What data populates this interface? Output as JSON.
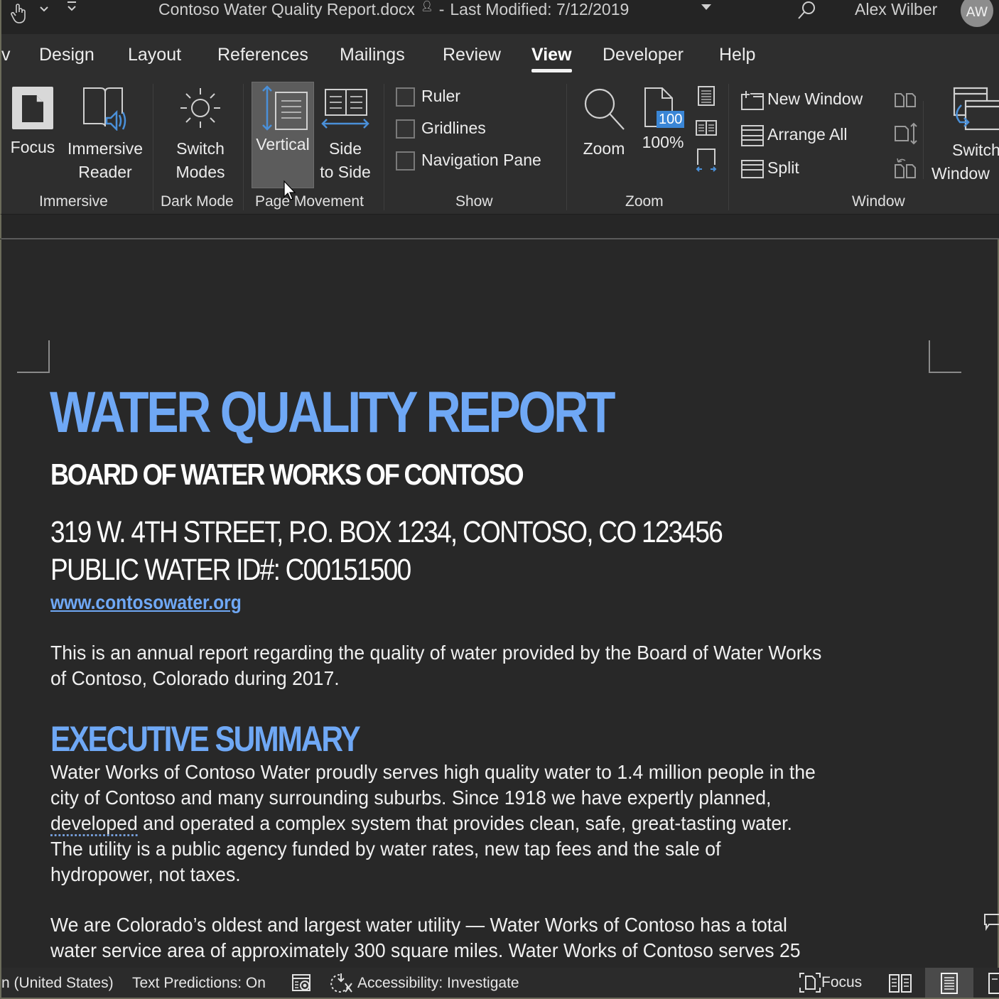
{
  "titlebar": {
    "doc_name": "Contoso Water Quality Report.docx",
    "separator": "-",
    "last_modified": "Last Modified: 7/12/2019",
    "user_name": "Alex Wilber",
    "avatar_initials": "AW"
  },
  "tabs": [
    {
      "label": "v"
    },
    {
      "label": "Design"
    },
    {
      "label": "Layout"
    },
    {
      "label": "References"
    },
    {
      "label": "Mailings"
    },
    {
      "label": "Review"
    },
    {
      "label": "View",
      "active": true
    },
    {
      "label": "Developer"
    },
    {
      "label": "Help"
    }
  ],
  "ribbon": {
    "immersive": {
      "label": "Immersive",
      "focus": "Focus",
      "immersive_reader_1": "Immersive",
      "immersive_reader_2": "Reader"
    },
    "dark_mode": {
      "label": "Dark Mode",
      "switch_1": "Switch",
      "switch_2": "Modes"
    },
    "page_movement": {
      "label": "Page Movement",
      "vertical": "Vertical",
      "side_1": "Side",
      "side_2": "to Side"
    },
    "show": {
      "label": "Show",
      "ruler": "Ruler",
      "gridlines": "Gridlines",
      "navigation_pane": "Navigation Pane",
      "ruler_checked": false,
      "gridlines_checked": false,
      "navigation_pane_checked": false
    },
    "zoom": {
      "label": "Zoom",
      "zoom": "Zoom",
      "hundred": "100%",
      "badge": "100"
    },
    "window": {
      "label": "Window",
      "new_window": "New Window",
      "arrange_all": "Arrange All",
      "split": "Split",
      "switch_1": "Switch",
      "switch_2": "Window"
    }
  },
  "document": {
    "title": "WATER QUALITY REPORT",
    "board": "BOARD OF WATER WORKS OF CONTOSO",
    "address": "319 W. 4TH STREET, P.O. BOX 1234, CONTOSO, CO 123456",
    "public_id": "PUBLIC WATER ID#: C00151500",
    "website": "www.contosowater.org",
    "intro_lines": [
      "This is an annual report regarding the quality of water provided by the Board of Water Works",
      "of Contoso, Colorado during 2017."
    ],
    "exec_heading": "EXECUTIVE SUMMARY",
    "exec_lines": [
      "Water Works of Contoso Water proudly serves high quality water to 1.4 million people in the",
      "city of Contoso and many surrounding suburbs. Since 1918 we have expertly planned,",
      "and operated a complex system that provides clean, safe, great-tasting water.",
      "The utility is a public agency funded by water rates, new tap fees and the sale of",
      "hydropower, not taxes."
    ],
    "exec_flagged_word": "developed",
    "para2_lines": [
      "We are Colorado’s oldest and largest water utility — Water Works of Contoso has a total",
      "water service area of approximately 300 square miles. Water Works of Contoso serves 25"
    ]
  },
  "statusbar": {
    "language": "n (United States)",
    "text_predictions": "Text Predictions: On",
    "accessibility": "Accessibility: Investigate",
    "focus": "Focus"
  },
  "colors": {
    "accent": "#6fa8f5",
    "ribbon_blue": "#4a90d9"
  }
}
